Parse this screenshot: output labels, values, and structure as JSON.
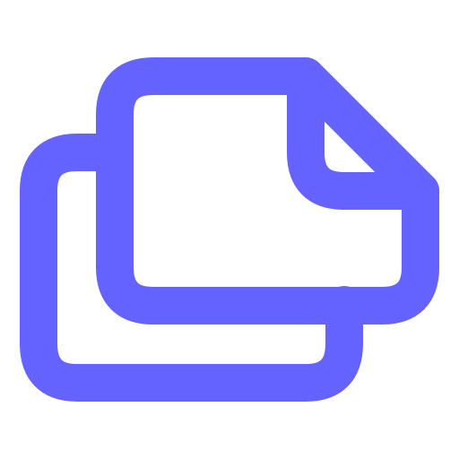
{
  "icon": {
    "name": "copy-document-icon",
    "color": "#6563FF"
  }
}
